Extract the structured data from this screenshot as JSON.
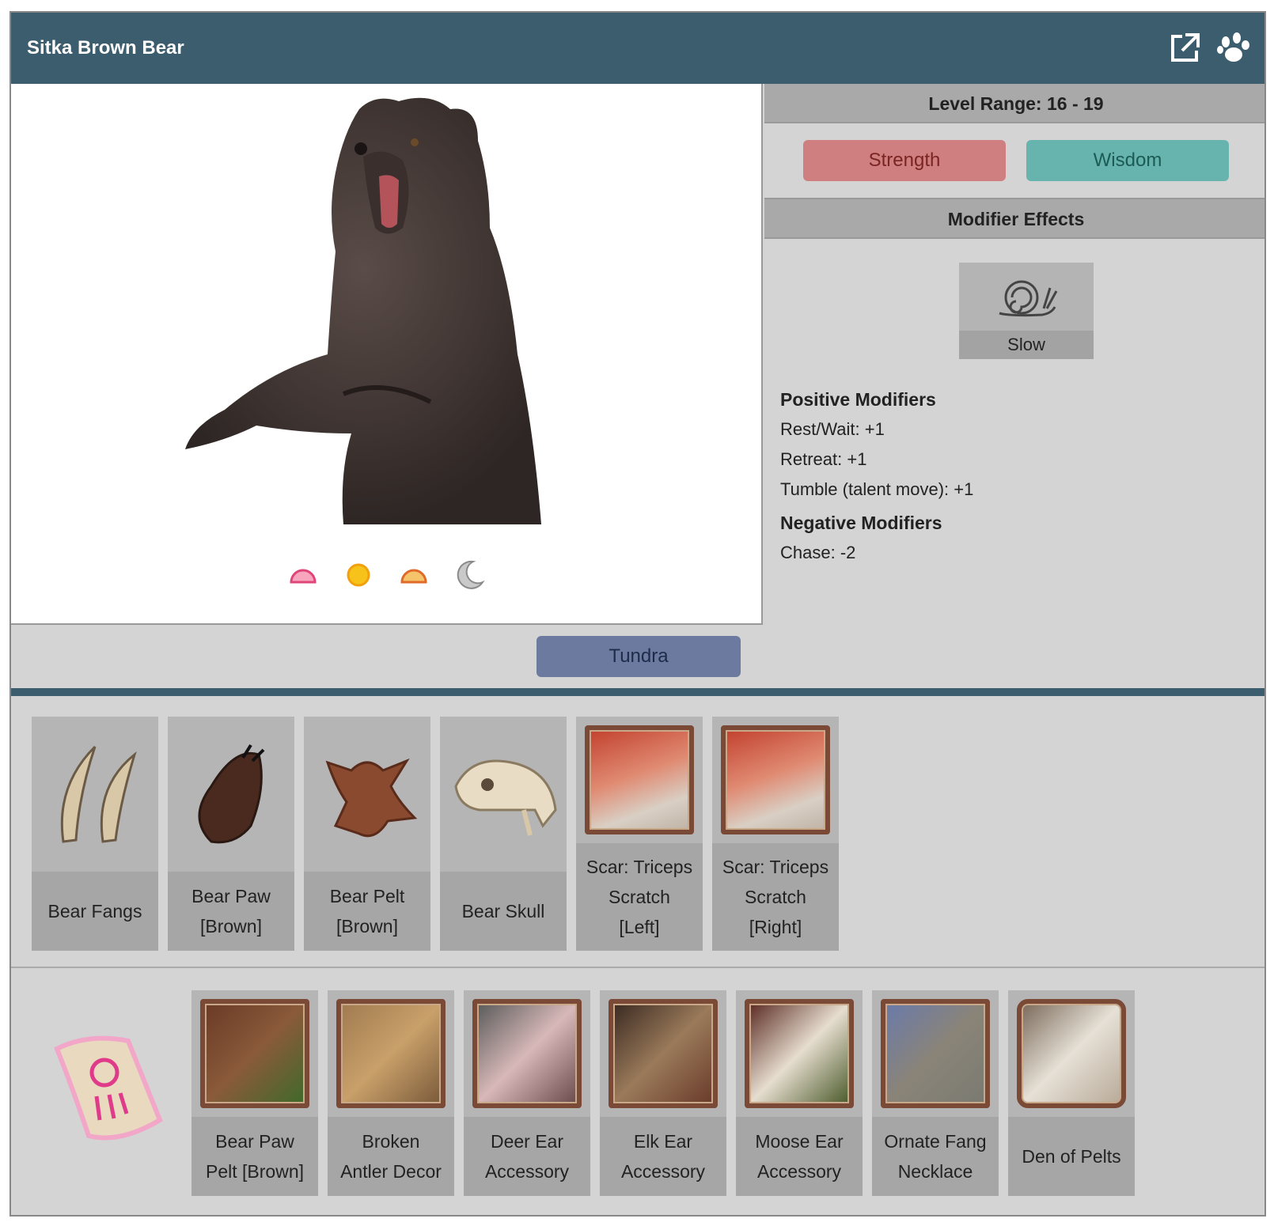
{
  "header": {
    "title": "Sitka Brown Bear"
  },
  "icons": {
    "external": "external-link-icon",
    "paw": "paw-icon"
  },
  "level": {
    "label": "Level Range: 16 - 19"
  },
  "stats": [
    {
      "label": "Strength",
      "color": "#cf7f7f"
    },
    {
      "label": "Wisdom",
      "color": "#67b4ae"
    }
  ],
  "modifiers": {
    "heading": "Modifier Effects",
    "effect": {
      "label": "Slow",
      "icon": "snail-icon"
    },
    "positive_heading": "Positive Modifiers",
    "positive": [
      "Rest/Wait: +1",
      "Retreat: +1",
      "Tumble (talent move): +1"
    ],
    "negative_heading": "Negative Modifiers",
    "negative": [
      "Chase: -2"
    ]
  },
  "time_icons": [
    "dawn-icon",
    "day-icon",
    "dusk-icon",
    "night-icon"
  ],
  "habitat": {
    "label": "Tundra"
  },
  "drops": [
    {
      "line1": "Bear Fangs",
      "line2": "",
      "line3": ""
    },
    {
      "line1": "Bear Paw",
      "line2": "[Brown]",
      "line3": ""
    },
    {
      "line1": "Bear Pelt",
      "line2": "[Brown]",
      "line3": ""
    },
    {
      "line1": "Bear Skull",
      "line2": "",
      "line3": ""
    },
    {
      "line1": "Scar: Triceps",
      "line2": "Scratch",
      "line3": "[Left]"
    },
    {
      "line1": "Scar: Triceps",
      "line2": "Scratch",
      "line3": "[Right]"
    }
  ],
  "quest_items": [
    {
      "line1": "Bear Paw",
      "line2": "Pelt [Brown]"
    },
    {
      "line1": "Broken",
      "line2": "Antler Decor"
    },
    {
      "line1": "Deer Ear",
      "line2": "Accessory"
    },
    {
      "line1": "Elk Ear",
      "line2": "Accessory"
    },
    {
      "line1": "Moose Ear",
      "line2": "Accessory"
    },
    {
      "line1": "Ornate Fang",
      "line2": "Necklace"
    },
    {
      "line1": "Den of Pelts",
      "line2": ""
    }
  ]
}
